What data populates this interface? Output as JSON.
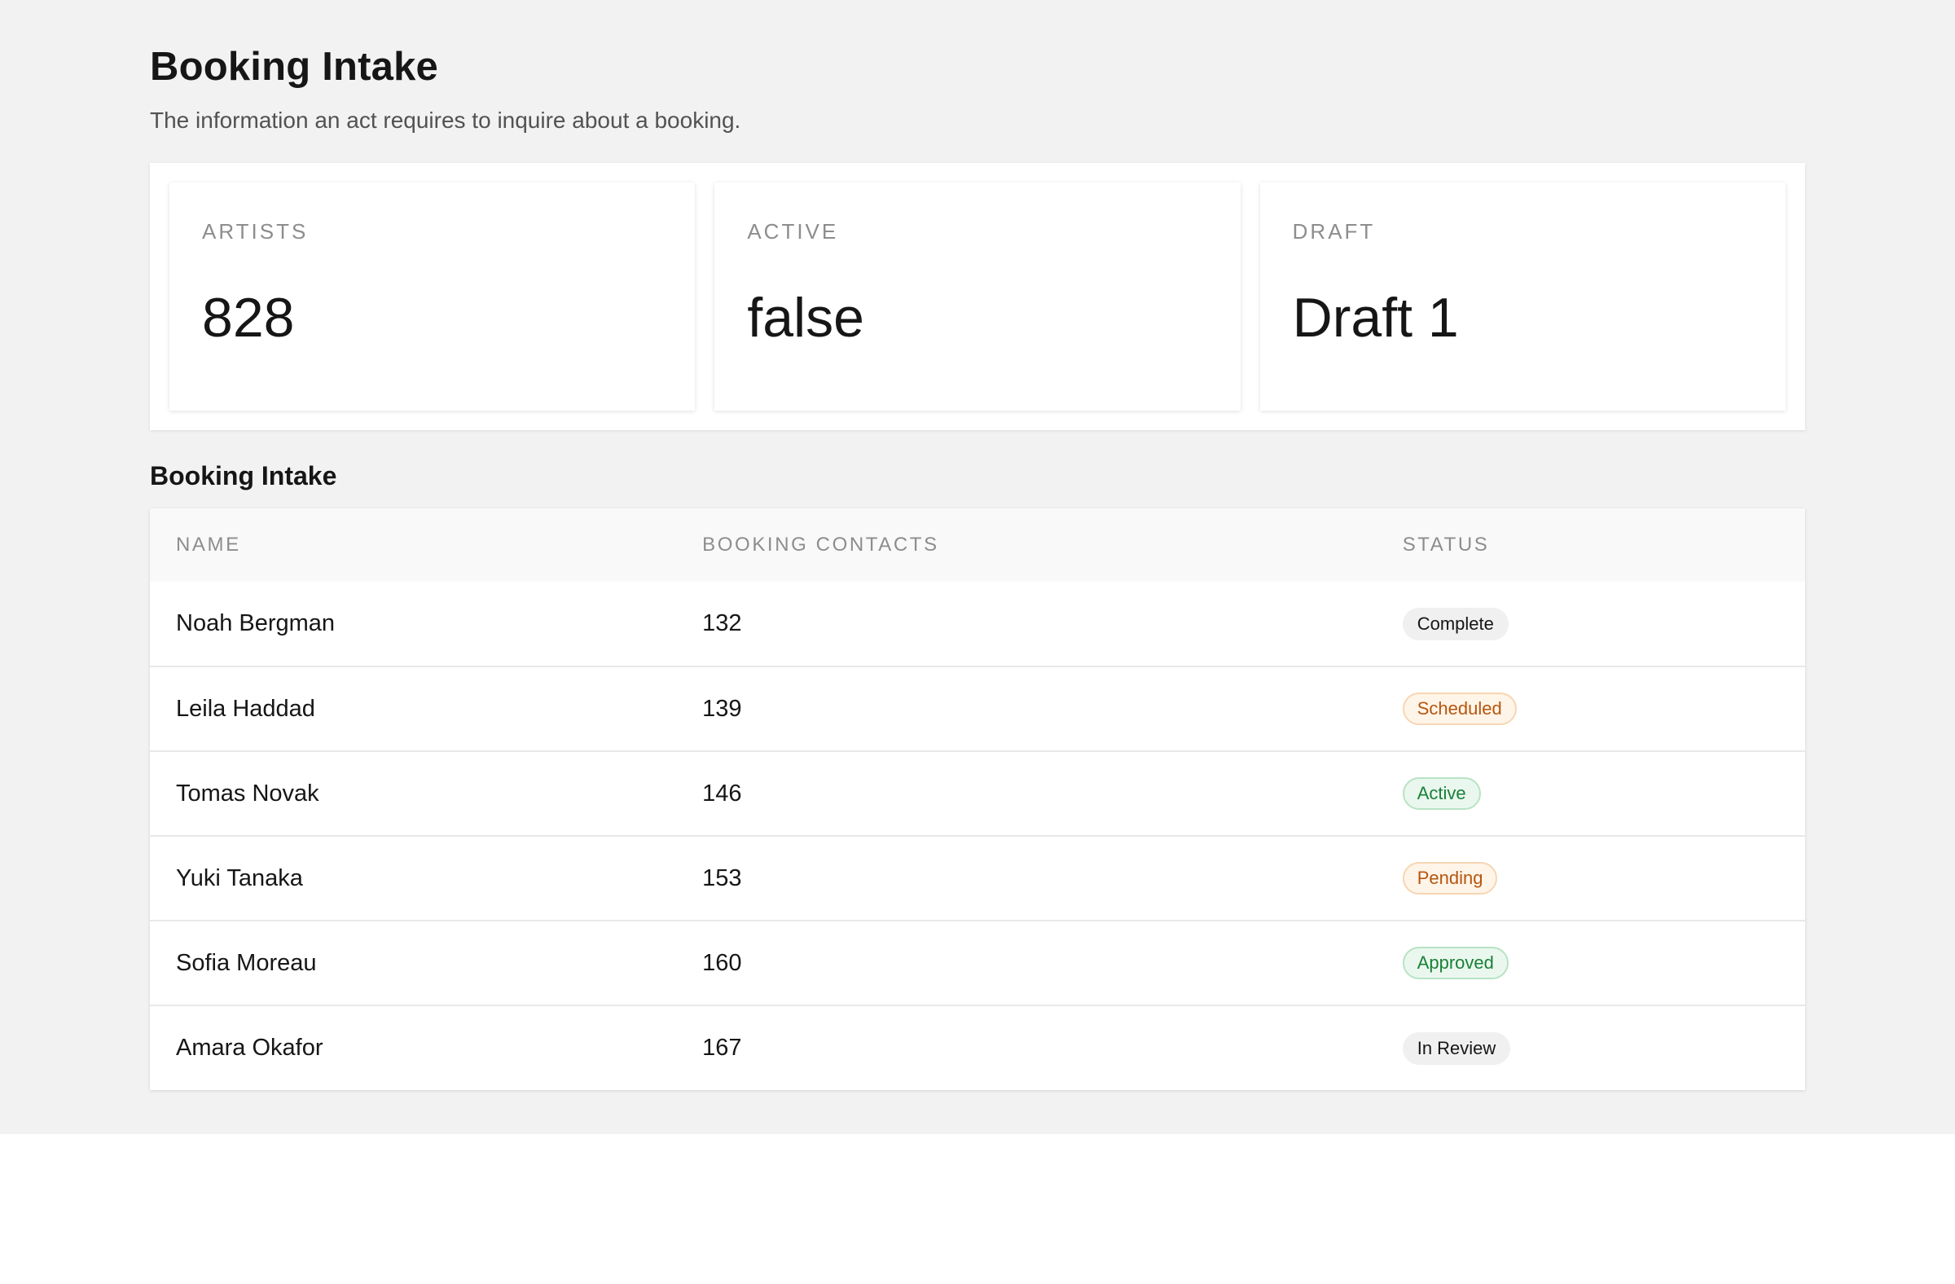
{
  "header": {
    "title": "Booking Intake",
    "subtitle": "The information an act requires to inquire about a booking."
  },
  "stats": [
    {
      "label": "ARTISTS",
      "value": "828"
    },
    {
      "label": "ACTIVE",
      "value": "false"
    },
    {
      "label": "DRAFT",
      "value": "Draft 1"
    }
  ],
  "section": {
    "title": "Booking Intake"
  },
  "table": {
    "columns": [
      "NAME",
      "BOOKING CONTACTS",
      "STATUS"
    ],
    "rows": [
      {
        "name": "Noah Bergman",
        "contacts": "132",
        "status": "Complete",
        "tone": "neutral"
      },
      {
        "name": "Leila Haddad",
        "contacts": "139",
        "status": "Scheduled",
        "tone": "warning"
      },
      {
        "name": "Tomas Novak",
        "contacts": "146",
        "status": "Active",
        "tone": "success"
      },
      {
        "name": "Yuki Tanaka",
        "contacts": "153",
        "status": "Pending",
        "tone": "warning"
      },
      {
        "name": "Sofia Moreau",
        "contacts": "160",
        "status": "Approved",
        "tone": "success"
      },
      {
        "name": "Amara Okafor",
        "contacts": "167",
        "status": "In Review",
        "tone": "neutral"
      }
    ]
  },
  "colors": {
    "page_background": "#f2f2f2",
    "warning_text": "#b5560e",
    "success_text": "#198038"
  }
}
